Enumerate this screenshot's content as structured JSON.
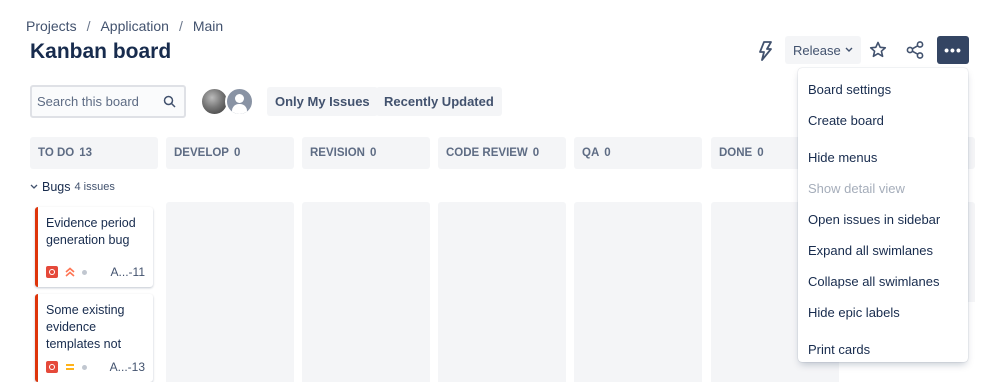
{
  "breadcrumb": [
    "Projects",
    "Application",
    "Main"
  ],
  "page_title": "Kanban board",
  "toolbar": {
    "release_label": "Release",
    "more_label": "•••"
  },
  "search": {
    "placeholder": "Search this board"
  },
  "filters": [
    "Only My Issues",
    "Recently Updated"
  ],
  "columns": [
    {
      "name": "TO DO",
      "count": "13"
    },
    {
      "name": "DEVELOP",
      "count": "0"
    },
    {
      "name": "REVISION",
      "count": "0"
    },
    {
      "name": "CODE REVIEW",
      "count": "0"
    },
    {
      "name": "QA",
      "count": "0"
    },
    {
      "name": "DONE",
      "count": "0"
    }
  ],
  "swimlane": {
    "title": "Bugs",
    "count": "4 issues"
  },
  "cards": [
    {
      "summary": "Evidence period generation bug",
      "key": "A...-11",
      "priority": "high"
    },
    {
      "summary": "Some existing evidence templates not",
      "key": "A...-13",
      "priority": "medium"
    }
  ],
  "menu": [
    {
      "label": "Board settings",
      "disabled": false
    },
    {
      "label": "Create board",
      "disabled": false
    },
    {
      "label": "Hide menus",
      "disabled": false
    },
    {
      "label": "Show detail view",
      "disabled": true
    },
    {
      "label": "Open issues in sidebar",
      "disabled": false
    },
    {
      "label": "Expand all swimlanes",
      "disabled": false
    },
    {
      "label": "Collapse all swimlanes",
      "disabled": false
    },
    {
      "label": "Hide epic labels",
      "disabled": false
    },
    {
      "label": "Print cards",
      "disabled": false
    }
  ],
  "colors": {
    "accent_dark": "#344563",
    "bug_red": "#e5493a",
    "priority_high": "#ff7452",
    "priority_medium": "#ffab00"
  },
  "icons": [
    "automation-bolt-icon",
    "chevron-down-icon",
    "star-icon",
    "share-icon",
    "more-icon",
    "search-icon",
    "bug-icon",
    "priority-icon"
  ]
}
